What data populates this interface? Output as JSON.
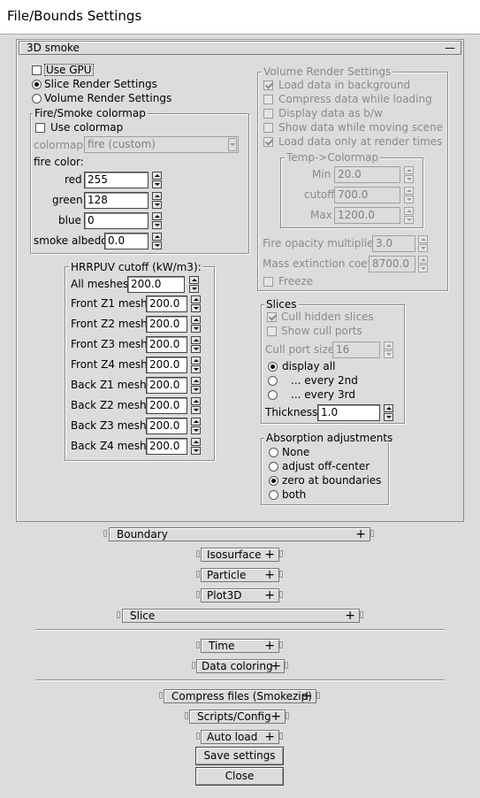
{
  "window": {
    "title": "File/Bounds Settings"
  },
  "smoke3d": {
    "rollout_title": "3D smoke",
    "rollout_toggle": "—",
    "use_gpu": "Use GPU",
    "slice_render": "Slice Render Settings",
    "volume_render": "Volume Render Settings",
    "render_mode": "slice",
    "fire_colormap": {
      "title": "Fire/Smoke colormap",
      "use_colormap": "Use colormap",
      "colormap_label": "colormap:",
      "colormap_value": "fire (custom)",
      "fire_color_label": "fire color:",
      "red_label": "red",
      "red_value": "255",
      "green_label": "green",
      "green_value": "128",
      "blue_label": "blue",
      "blue_value": "0",
      "albedo_label": "smoke albedo",
      "albedo_value": "0.0"
    },
    "hrrpuv": {
      "title": "HRRPUV cutoff (kW/m3):",
      "rows": [
        {
          "label": "All meshes",
          "value": "200.0"
        },
        {
          "label": "Front Z1 mesh",
          "value": "200.0"
        },
        {
          "label": "Front Z2 mesh",
          "value": "200.0"
        },
        {
          "label": "Front Z3 mesh",
          "value": "200.0"
        },
        {
          "label": "Front Z4 mesh",
          "value": "200.0"
        },
        {
          "label": "Back Z1 mesh",
          "value": "200.0"
        },
        {
          "label": "Back Z2 mesh",
          "value": "200.0"
        },
        {
          "label": "Back Z3 mesh",
          "value": "200.0"
        },
        {
          "label": "Back Z4 mesh",
          "value": "200.0"
        }
      ]
    },
    "volume_settings": {
      "title": "Volume Render Settings",
      "load_background": "Load data in background",
      "compress_loading": "Compress data while loading",
      "display_bw": "Display data as b/w",
      "show_moving": "Show data while moving scene",
      "load_render_times": "Load data only at render times",
      "temp_colormap": {
        "title": "Temp->Colormap",
        "min_label": "Min",
        "min_value": "20.0",
        "cutoff_label": "cutoff",
        "cutoff_value": "700.0",
        "max_label": "Max",
        "max_value": "1200.0"
      },
      "fire_opacity_label": "Fire opacity multiplier",
      "fire_opacity_value": "3.0",
      "mass_ext_label": "Mass extinction coeff",
      "mass_ext_value": "8700.0",
      "freeze": "Freeze"
    },
    "slices": {
      "title": "Slices",
      "cull_hidden": "Cull hidden slices",
      "show_cull": "Show cull ports",
      "cull_port_label": "Cull port size",
      "cull_port_value": "16",
      "display_all": "display all",
      "every_2nd": "... every 2nd",
      "every_3rd": "... every 3rd",
      "display_selected": "all",
      "thickness_label": "Thickness",
      "thickness_value": "1.0"
    },
    "absorption": {
      "title": "Absorption adjustments",
      "none": "None",
      "off_center": "adjust off-center",
      "zero_boundaries": "zero at boundaries",
      "both": "both",
      "selected": "zero_boundaries"
    }
  },
  "rollouts": {
    "boundary": "Boundary",
    "isosurface": "Isosurface",
    "particle": "Particle",
    "plot3d": "Plot3D",
    "slice": "Slice",
    "time": "Time",
    "data_coloring": "Data coloring",
    "compress_files": "Compress files (Smokezip)",
    "scripts_config": "Scripts/Config",
    "auto_load": "Auto load",
    "plus": "+"
  },
  "buttons": {
    "save": "Save settings",
    "close": "Close"
  }
}
